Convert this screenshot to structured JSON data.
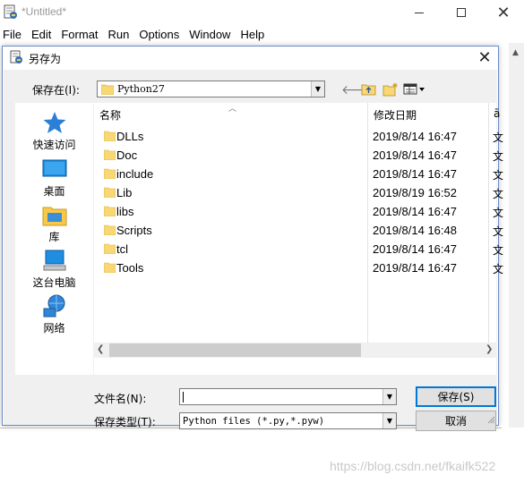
{
  "main_window": {
    "title": "*Untitled*",
    "menu": [
      "File",
      "Edit",
      "Format",
      "Run",
      "Options",
      "Window",
      "Help"
    ],
    "controls": {
      "minimize": "",
      "maximize": "",
      "close": "✕"
    }
  },
  "dialog": {
    "title": "另存为",
    "close": "✕",
    "save_in_label": "保存在(I):",
    "save_in_value": "Python27",
    "places": [
      {
        "label": "快速访问",
        "icon": "star-icon"
      },
      {
        "label": "桌面",
        "icon": "desktop-icon"
      },
      {
        "label": "库",
        "icon": "library-icon"
      },
      {
        "label": "这台电脑",
        "icon": "computer-icon"
      },
      {
        "label": "网络",
        "icon": "network-icon"
      }
    ],
    "columns": {
      "name": "名称",
      "date": "修改日期",
      "type": "ā"
    },
    "files": [
      {
        "name": "DLLs",
        "date": "2019/8/14 16:47",
        "type": "文"
      },
      {
        "name": "Doc",
        "date": "2019/8/14 16:47",
        "type": "文"
      },
      {
        "name": "include",
        "date": "2019/8/14 16:47",
        "type": "文"
      },
      {
        "name": "Lib",
        "date": "2019/8/19 16:52",
        "type": "文"
      },
      {
        "name": "libs",
        "date": "2019/8/14 16:47",
        "type": "文"
      },
      {
        "name": "Scripts",
        "date": "2019/8/14 16:48",
        "type": "文"
      },
      {
        "name": "tcl",
        "date": "2019/8/14 16:47",
        "type": "文"
      },
      {
        "name": "Tools",
        "date": "2019/8/14 16:47",
        "type": "文"
      }
    ],
    "filename_label": "文件名(N):",
    "filename_value": "",
    "filetype_label": "保存类型(T):",
    "filetype_value": "Python files (*.py,*.pyw)",
    "save_button": "保存(S)",
    "cancel_button": "取消"
  },
  "watermark": "https://blog.csdn.net/fkaifk522",
  "colors": {
    "accent": "#0078d7",
    "folder": "#f8d775",
    "dialog_bg": "#f0f0f0"
  }
}
